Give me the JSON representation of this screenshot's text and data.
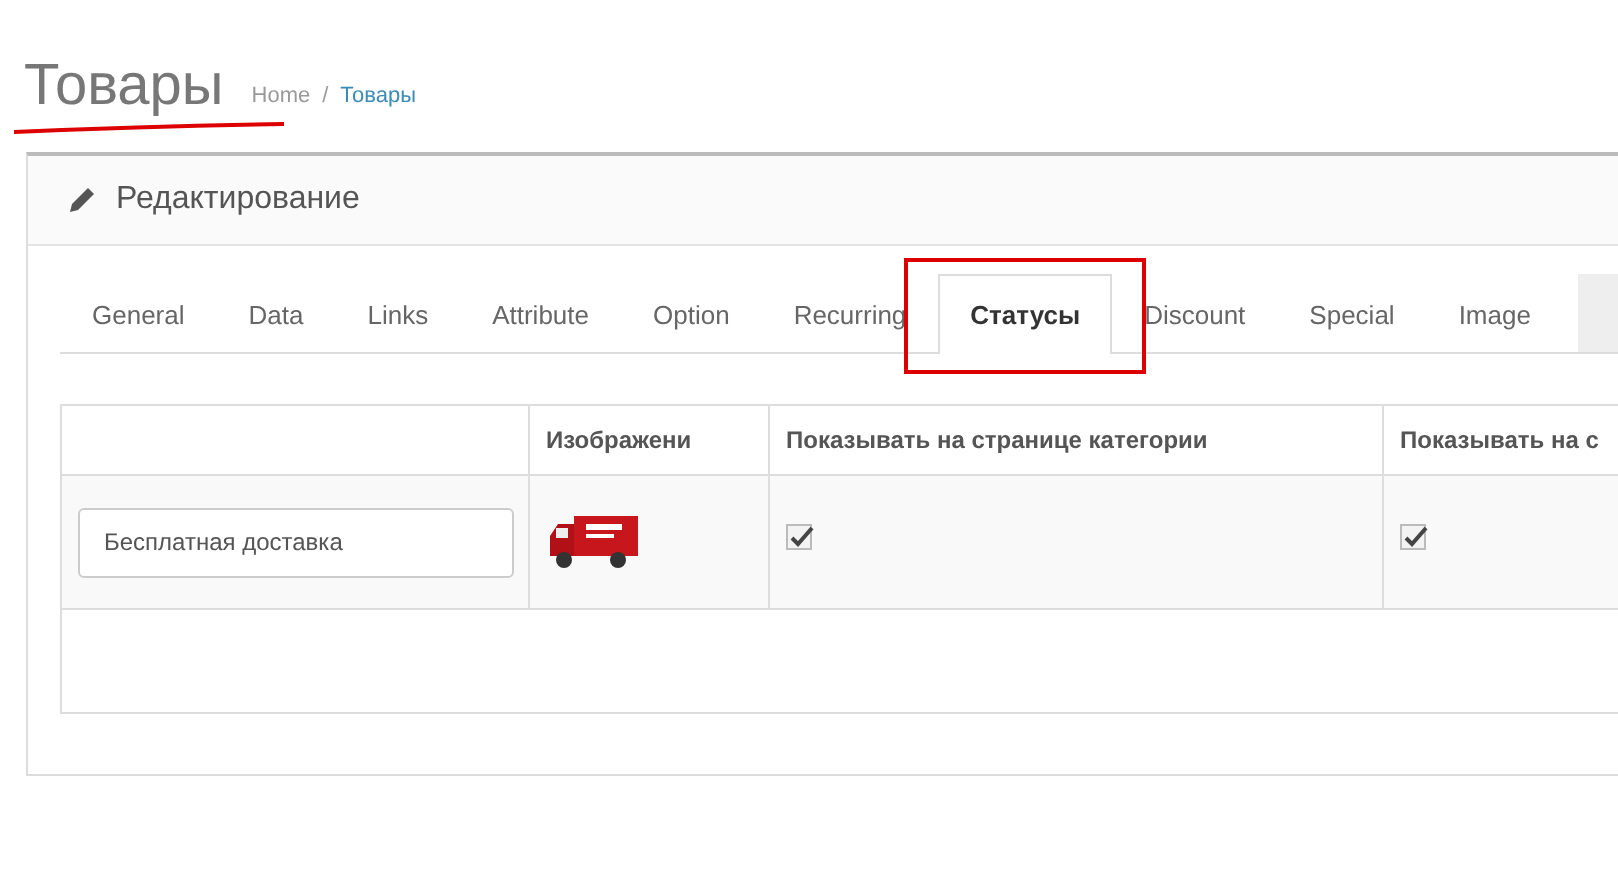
{
  "page_title": "Товары",
  "breadcrumb": [
    {
      "label": "Home",
      "link": false
    },
    {
      "label": "Товары",
      "link": true
    }
  ],
  "breadcrumb_separator": "/",
  "panel": {
    "title": "Редактирование"
  },
  "tabs": [
    {
      "label": "General",
      "selected": false
    },
    {
      "label": "Data",
      "selected": false
    },
    {
      "label": "Links",
      "selected": false
    },
    {
      "label": "Attribute",
      "selected": false
    },
    {
      "label": "Option",
      "selected": false
    },
    {
      "label": "Recurring",
      "selected": false
    },
    {
      "label": "Статусы",
      "selected": true
    },
    {
      "label": "Discount",
      "selected": false
    },
    {
      "label": "Special",
      "selected": false
    },
    {
      "label": "Image",
      "selected": false
    }
  ],
  "table": {
    "columns": [
      "Изображени",
      "Показывать на странице категории",
      "Показывать на с"
    ],
    "rows": [
      {
        "name": "Бесплатная доставка",
        "show_on_category": true,
        "show_on_column_4": true
      }
    ]
  }
}
